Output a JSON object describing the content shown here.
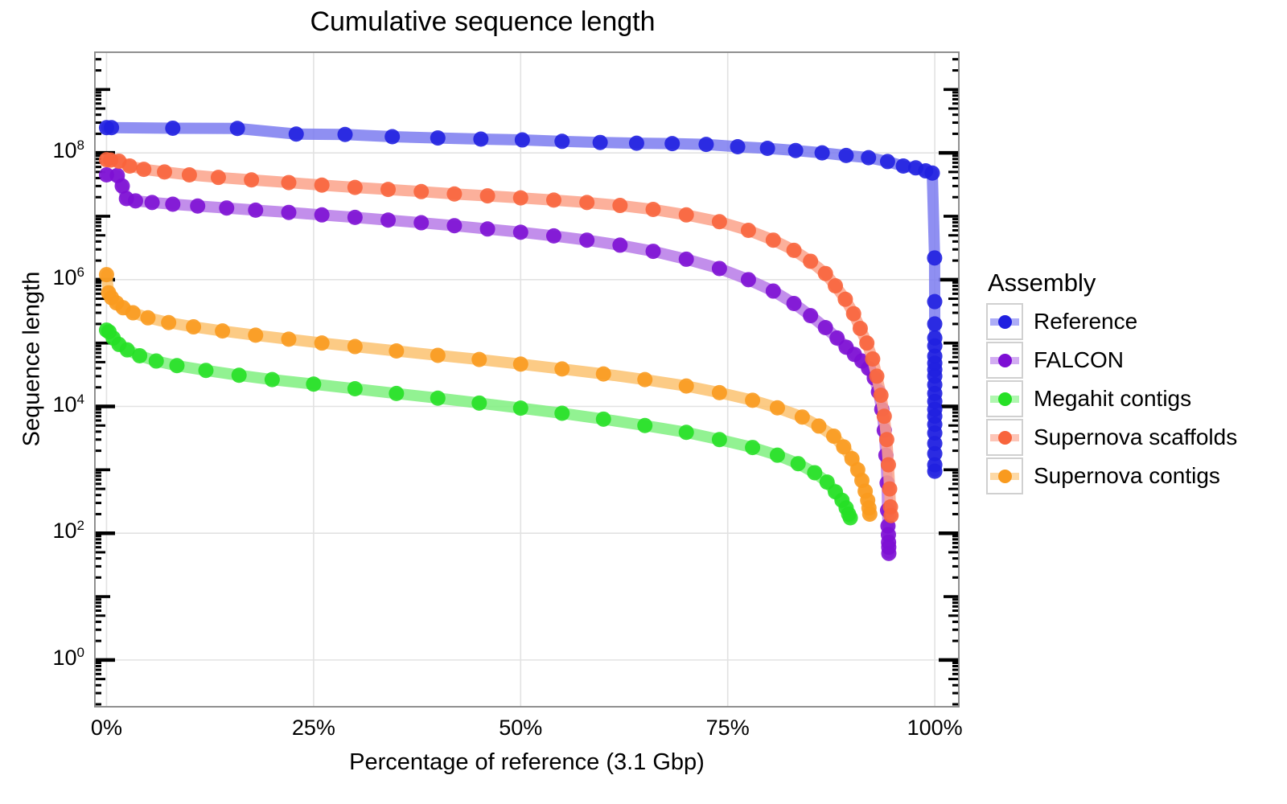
{
  "chart_data": {
    "type": "line",
    "title": "Cumulative sequence length",
    "xlabel": "Percentage of reference (3.1 Gbp)",
    "ylabel": "Sequence length",
    "x_ticks": [
      "0%",
      "25%",
      "50%",
      "75%",
      "100%"
    ],
    "x_tick_values": [
      0,
      25,
      50,
      75,
      100
    ],
    "xlim": [
      -1.5,
      103
    ],
    "y_ticks": [
      "10^0",
      "10^2",
      "10^4",
      "10^6",
      "10^8"
    ],
    "y_tick_values": [
      1,
      100,
      10000,
      1000000,
      100000000
    ],
    "ylim_log10": [
      -0.75,
      9.6
    ],
    "yscale": "log",
    "grid": true,
    "legend_position": "right",
    "legend_title": "Assembly",
    "series": [
      {
        "name": "Reference",
        "color": "#2020e0",
        "line_color": "#7b7bf0",
        "points": [
          [
            0.0,
            250000000
          ],
          [
            0.6,
            250000000
          ],
          [
            8.0,
            245000000
          ],
          [
            15.8,
            243000000
          ],
          [
            22.9,
            198000000
          ],
          [
            28.8,
            195000000
          ],
          [
            34.5,
            180000000
          ],
          [
            40.0,
            172000000
          ],
          [
            45.2,
            165000000
          ],
          [
            50.2,
            160000000
          ],
          [
            55.0,
            152000000
          ],
          [
            59.6,
            146000000
          ],
          [
            64.0,
            142000000
          ],
          [
            68.3,
            140000000
          ],
          [
            72.4,
            136000000
          ],
          [
            76.2,
            125000000
          ],
          [
            79.8,
            118000000
          ],
          [
            83.2,
            109000000
          ],
          [
            86.4,
            100000000
          ],
          [
            89.3,
            91000000
          ],
          [
            92.0,
            84000000
          ],
          [
            94.3,
            73000000
          ],
          [
            96.2,
            62000000
          ],
          [
            97.7,
            58000000
          ],
          [
            98.9,
            52000000
          ],
          [
            99.7,
            48000000
          ],
          [
            99.98,
            2200000
          ],
          [
            99.99,
            450000
          ],
          [
            99.995,
            200000
          ],
          [
            100.0,
            120000
          ],
          [
            100.0,
            90000
          ],
          [
            100.0,
            62000
          ],
          [
            100.0,
            48000
          ],
          [
            100.0,
            38000
          ],
          [
            100.0,
            30000
          ],
          [
            100.0,
            22000
          ],
          [
            100.0,
            16000
          ],
          [
            100.0,
            12000
          ],
          [
            100.0,
            9000
          ],
          [
            100.0,
            7000
          ],
          [
            100.0,
            5200
          ],
          [
            100.0,
            3800
          ],
          [
            100.0,
            2600
          ],
          [
            100.0,
            1800
          ],
          [
            100.0,
            1200
          ],
          [
            100.0,
            950
          ]
        ]
      },
      {
        "name": "FALCON",
        "color": "#7d0fd4",
        "line_color": "#b77ae8",
        "points": [
          [
            0.0,
            45000000
          ],
          [
            1.3,
            44000000
          ],
          [
            1.9,
            30000000
          ],
          [
            2.4,
            19000000
          ],
          [
            3.5,
            17500000
          ],
          [
            5.5,
            16500000
          ],
          [
            8.0,
            15500000
          ],
          [
            11.0,
            14500000
          ],
          [
            14.5,
            13500000
          ],
          [
            18.0,
            12500000
          ],
          [
            22.0,
            11500000
          ],
          [
            26.0,
            10500000
          ],
          [
            30.0,
            9600000
          ],
          [
            34.0,
            8700000
          ],
          [
            38.0,
            7900000
          ],
          [
            42.0,
            7100000
          ],
          [
            46.0,
            6300000
          ],
          [
            50.0,
            5600000
          ],
          [
            54.0,
            4900000
          ],
          [
            58.0,
            4200000
          ],
          [
            62.0,
            3500000
          ],
          [
            66.0,
            2800000
          ],
          [
            70.0,
            2100000
          ],
          [
            74.0,
            1500000
          ],
          [
            77.5,
            1000000
          ],
          [
            80.5,
            660000
          ],
          [
            83.0,
            420000
          ],
          [
            85.0,
            270000
          ],
          [
            86.8,
            175000
          ],
          [
            88.2,
            120000
          ],
          [
            89.3,
            86000
          ],
          [
            90.3,
            66000
          ],
          [
            91.2,
            52000
          ],
          [
            92.0,
            40000
          ],
          [
            92.7,
            28000
          ],
          [
            93.2,
            17000
          ],
          [
            93.6,
            9000
          ],
          [
            93.9,
            4200
          ],
          [
            94.1,
            1700
          ],
          [
            94.25,
            620
          ],
          [
            94.3,
            230
          ],
          [
            94.35,
            130
          ],
          [
            94.4,
            95
          ],
          [
            94.42,
            72
          ],
          [
            94.44,
            60
          ],
          [
            94.45,
            48
          ]
        ]
      },
      {
        "name": "Megahit contigs",
        "color": "#26e026",
        "line_color": "#7ff07f",
        "points": [
          [
            0.0,
            160000
          ],
          [
            0.3,
            150000
          ],
          [
            0.8,
            120000
          ],
          [
            1.5,
            95000
          ],
          [
            2.5,
            78000
          ],
          [
            4.0,
            63000
          ],
          [
            6.0,
            52000
          ],
          [
            8.5,
            44000
          ],
          [
            12.0,
            37000
          ],
          [
            16.0,
            31000
          ],
          [
            20.0,
            26500
          ],
          [
            25.0,
            22500
          ],
          [
            30.0,
            19000
          ],
          [
            35.0,
            16000
          ],
          [
            40.0,
            13500
          ],
          [
            45.0,
            11300
          ],
          [
            50.0,
            9400
          ],
          [
            55.0,
            7800
          ],
          [
            60.0,
            6300
          ],
          [
            65.0,
            5000
          ],
          [
            70.0,
            3900
          ],
          [
            74.0,
            3000
          ],
          [
            78.0,
            2250
          ],
          [
            81.0,
            1700
          ],
          [
            83.5,
            1250
          ],
          [
            85.5,
            900
          ],
          [
            87.0,
            640
          ],
          [
            88.0,
            450
          ],
          [
            88.8,
            330
          ],
          [
            89.3,
            250
          ],
          [
            89.6,
            200
          ],
          [
            89.8,
            175
          ]
        ]
      },
      {
        "name": "Supernova scaffolds",
        "color": "#f8643c",
        "line_color": "#fba28a",
        "points": [
          [
            0.0,
            78000000
          ],
          [
            0.5,
            77000000
          ],
          [
            1.5,
            74000000
          ],
          [
            2.8,
            62000000
          ],
          [
            4.5,
            55000000
          ],
          [
            7.0,
            50000000
          ],
          [
            10.0,
            45000000
          ],
          [
            13.5,
            41000000
          ],
          [
            17.5,
            37500000
          ],
          [
            22.0,
            34000000
          ],
          [
            26.0,
            31000000
          ],
          [
            30.0,
            28500000
          ],
          [
            34.0,
            26500000
          ],
          [
            38.0,
            24500000
          ],
          [
            42.0,
            22500000
          ],
          [
            46.0,
            21000000
          ],
          [
            50.0,
            19500000
          ],
          [
            54.0,
            18000000
          ],
          [
            58.0,
            16500000
          ],
          [
            62.0,
            14800000
          ],
          [
            66.0,
            12800000
          ],
          [
            70.0,
            10500000
          ],
          [
            74.0,
            8200000
          ],
          [
            77.5,
            6000000
          ],
          [
            80.5,
            4200000
          ],
          [
            83.0,
            2900000
          ],
          [
            85.0,
            1950000
          ],
          [
            86.8,
            1250000
          ],
          [
            88.0,
            800000
          ],
          [
            89.2,
            490000
          ],
          [
            90.2,
            290000
          ],
          [
            91.0,
            170000
          ],
          [
            91.8,
            100000
          ],
          [
            92.5,
            56000
          ],
          [
            93.0,
            30000
          ],
          [
            93.5,
            15000
          ],
          [
            93.9,
            7000
          ],
          [
            94.2,
            3000
          ],
          [
            94.4,
            1200
          ],
          [
            94.55,
            500
          ],
          [
            94.65,
            260
          ],
          [
            94.72,
            190
          ]
        ]
      },
      {
        "name": "Supernova contigs",
        "color": "#f99a1e",
        "line_color": "#fbc270",
        "points": [
          [
            0.0,
            1200000
          ],
          [
            0.25,
            620000
          ],
          [
            0.6,
            520000
          ],
          [
            1.2,
            430000
          ],
          [
            2.0,
            360000
          ],
          [
            3.2,
            300000
          ],
          [
            5.0,
            250000
          ],
          [
            7.5,
            210000
          ],
          [
            10.5,
            180000
          ],
          [
            14.0,
            155000
          ],
          [
            18.0,
            133000
          ],
          [
            22.0,
            115000
          ],
          [
            26.0,
            100000
          ],
          [
            30.0,
            88000
          ],
          [
            35.0,
            75000
          ],
          [
            40.0,
            64000
          ],
          [
            45.0,
            55000
          ],
          [
            50.0,
            46500
          ],
          [
            55.0,
            39000
          ],
          [
            60.0,
            32500
          ],
          [
            65.0,
            26500
          ],
          [
            70.0,
            21000
          ],
          [
            74.0,
            16500
          ],
          [
            78.0,
            12500
          ],
          [
            81.0,
            9500
          ],
          [
            84.0,
            6800
          ],
          [
            86.0,
            4900
          ],
          [
            87.8,
            3400
          ],
          [
            89.0,
            2300
          ],
          [
            90.0,
            1500
          ],
          [
            90.7,
            1000
          ],
          [
            91.2,
            680
          ],
          [
            91.6,
            460
          ],
          [
            91.9,
            330
          ],
          [
            92.05,
            250
          ],
          [
            92.15,
            200
          ]
        ]
      }
    ]
  }
}
